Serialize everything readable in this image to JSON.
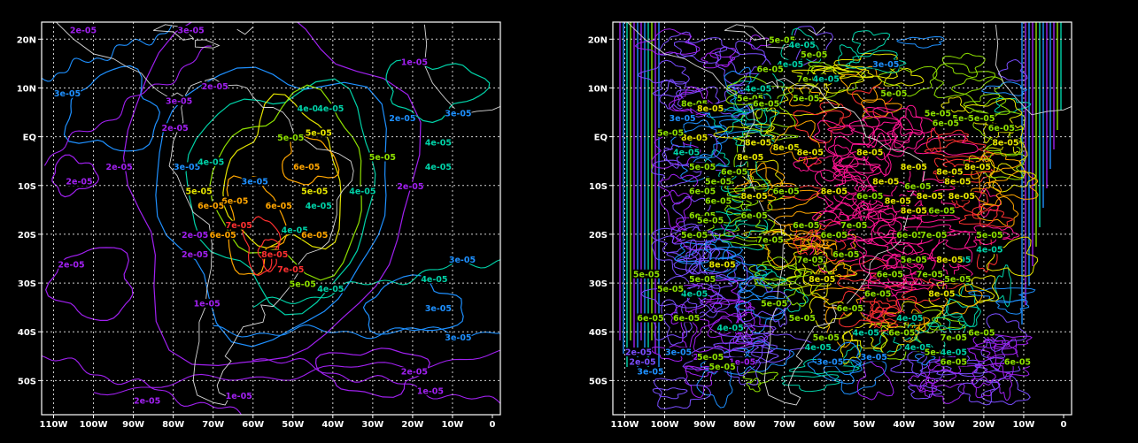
{
  "colors": {
    "c1": "#a020f0",
    "c2": "#7a4dff",
    "c3": "#1e90ff",
    "c4": "#00d2a8",
    "c5": "#8ee000",
    "c6": "#e6e600",
    "c7": "#ffa500",
    "c8": "#ff3030",
    "c9": "#ff1493"
  },
  "maps": [
    {
      "x_ticks": [
        "110W",
        "100W",
        "90W",
        "80W",
        "70W",
        "60W",
        "50W",
        "40W",
        "30W",
        "20W",
        "10W",
        "0"
      ],
      "y_ticks": [
        "20N",
        "10N",
        "EQ",
        "10S",
        "20S",
        "30S",
        "40S",
        "50S"
      ],
      "contour_labels": [
        {
          "t": "2e-05",
          "c": "c1",
          "lon": -103,
          "lat": 21.5
        },
        {
          "t": "3e-05",
          "c": "c1",
          "lon": -76,
          "lat": 21.5
        },
        {
          "t": "1e-05",
          "c": "c1",
          "lon": -20,
          "lat": 15
        },
        {
          "t": "2e-05",
          "c": "c1",
          "lon": -70,
          "lat": 10
        },
        {
          "t": "3e-05",
          "c": "c1",
          "lon": -79,
          "lat": 7
        },
        {
          "t": "3e-05",
          "c": "c3",
          "lon": -107,
          "lat": 8.5
        },
        {
          "t": "2e-05",
          "c": "c1",
          "lon": -80,
          "lat": 1.5
        },
        {
          "t": "4e-05",
          "c": "c4",
          "lon": -46,
          "lat": 5.5
        },
        {
          "t": "4e-05",
          "c": "c4",
          "lon": -41,
          "lat": 5.5
        },
        {
          "t": "2e-05",
          "c": "c3",
          "lon": -23,
          "lat": 3.5
        },
        {
          "t": "3e-05",
          "c": "c3",
          "lon": -9,
          "lat": 4.5
        },
        {
          "t": "4e-05",
          "c": "c4",
          "lon": -14,
          "lat": -1.5
        },
        {
          "t": "5e-05",
          "c": "c5",
          "lon": -51,
          "lat": -0.5
        },
        {
          "t": "5e-05",
          "c": "c6",
          "lon": -44,
          "lat": 0.5
        },
        {
          "t": "5e-05",
          "c": "c5",
          "lon": -28,
          "lat": -4.5
        },
        {
          "t": "4e-05",
          "c": "c4",
          "lon": -14,
          "lat": -6.5
        },
        {
          "t": "2e-05",
          "c": "c1",
          "lon": -94,
          "lat": -6.5
        },
        {
          "t": "3e-05",
          "c": "c3",
          "lon": -77,
          "lat": -6.5
        },
        {
          "t": "4e-05",
          "c": "c4",
          "lon": -71,
          "lat": -5.5
        },
        {
          "t": "6e-05",
          "c": "c7",
          "lon": -47,
          "lat": -6.5
        },
        {
          "t": "2e-05",
          "c": "c1",
          "lon": -104,
          "lat": -9.5
        },
        {
          "t": "3e-05",
          "c": "c3",
          "lon": -60,
          "lat": -9.5
        },
        {
          "t": "5e-05",
          "c": "c6",
          "lon": -45,
          "lat": -11.5
        },
        {
          "t": "4e-05",
          "c": "c4",
          "lon": -33,
          "lat": -11.5
        },
        {
          "t": "2e-05",
          "c": "c1",
          "lon": -21,
          "lat": -10.5
        },
        {
          "t": "5e-05",
          "c": "c6",
          "lon": -74,
          "lat": -11.5
        },
        {
          "t": "6e-05",
          "c": "c7",
          "lon": -65,
          "lat": -13.5
        },
        {
          "t": "6e-05",
          "c": "c7",
          "lon": -54,
          "lat": -14.5
        },
        {
          "t": "4e-05",
          "c": "c4",
          "lon": -44,
          "lat": -14.5
        },
        {
          "t": "6e-05",
          "c": "c7",
          "lon": -71,
          "lat": -14.5
        },
        {
          "t": "4e-05",
          "c": "c4",
          "lon": -50,
          "lat": -19.5
        },
        {
          "t": "7e-05",
          "c": "c8",
          "lon": -64,
          "lat": -18.5
        },
        {
          "t": "6e-05",
          "c": "c7",
          "lon": -68,
          "lat": -20.5
        },
        {
          "t": "6e-05",
          "c": "c7",
          "lon": -45,
          "lat": -20.5
        },
        {
          "t": "2e-05",
          "c": "c1",
          "lon": -75,
          "lat": -20.5
        },
        {
          "t": "2e-05",
          "c": "c1",
          "lon": -75,
          "lat": -24.5
        },
        {
          "t": "8e-05",
          "c": "c8",
          "lon": -55,
          "lat": -24.5
        },
        {
          "t": "7e-05",
          "c": "c8",
          "lon": -51,
          "lat": -27.5
        },
        {
          "t": "2e-05",
          "c": "c1",
          "lon": -106,
          "lat": -26.5
        },
        {
          "t": "3e-05",
          "c": "c3",
          "lon": -8,
          "lat": -25.5
        },
        {
          "t": "5e-05",
          "c": "c5",
          "lon": -48,
          "lat": -30.5
        },
        {
          "t": "4e-05",
          "c": "c4",
          "lon": -41,
          "lat": -31.5
        },
        {
          "t": "4e-05",
          "c": "c4",
          "lon": -15,
          "lat": -29.5
        },
        {
          "t": "1e-05",
          "c": "c1",
          "lon": -72,
          "lat": -34.5
        },
        {
          "t": "3e-05",
          "c": "c3",
          "lon": -14,
          "lat": -35.5
        },
        {
          "t": "3e-05",
          "c": "c3",
          "lon": -9,
          "lat": -41.5
        },
        {
          "t": "2e-05",
          "c": "c1",
          "lon": -20,
          "lat": -48.5
        },
        {
          "t": "1e-05",
          "c": "c1",
          "lon": -16,
          "lat": -52.5
        },
        {
          "t": "1e-05",
          "c": "c1",
          "lon": -64,
          "lat": -53.5
        },
        {
          "t": "2e-05",
          "c": "c1",
          "lon": -87,
          "lat": -54.5
        },
        {
          "t": "2e-05",
          "c": "c1",
          "lon": -104,
          "lat": -58.5
        }
      ]
    },
    {
      "x_ticks": [
        "110W",
        "100W",
        "90W",
        "80W",
        "70W",
        "60W",
        "50W",
        "40W",
        "30W",
        "20W",
        "10W",
        "0"
      ],
      "y_ticks": [
        "20N",
        "10N",
        "EQ",
        "10S",
        "20S",
        "30S",
        "40S",
        "50S"
      ],
      "contour_labels": [
        {
          "t": "5e-05",
          "c": "c5",
          "lon": -71,
          "lat": 19.5
        },
        {
          "t": "4e-05",
          "c": "c4",
          "lon": -66,
          "lat": 18.5
        },
        {
          "t": "4e-05",
          "c": "c4",
          "lon": -69,
          "lat": 14.5
        },
        {
          "t": "7e-05",
          "c": "c5",
          "lon": -64,
          "lat": 11.5
        },
        {
          "t": "4e-05",
          "c": "c4",
          "lon": -77,
          "lat": 9.5
        },
        {
          "t": "6e-05",
          "c": "c5",
          "lon": -74,
          "lat": 13.5
        },
        {
          "t": "5e-05",
          "c": "c5",
          "lon": -63,
          "lat": 16.5
        },
        {
          "t": "3e-05",
          "c": "c3",
          "lon": -45,
          "lat": 14.5
        },
        {
          "t": "5e-05",
          "c": "c5",
          "lon": -79,
          "lat": 7.5
        },
        {
          "t": "5e-05",
          "c": "c5",
          "lon": -65,
          "lat": 7.5
        },
        {
          "t": "4e-05",
          "c": "c4",
          "lon": -60,
          "lat": 11.5
        },
        {
          "t": "5e-05",
          "c": "c5",
          "lon": -43,
          "lat": 8.5
        },
        {
          "t": "8e-05",
          "c": "c5",
          "lon": -93,
          "lat": 6.5
        },
        {
          "t": "6e-05",
          "c": "c5",
          "lon": -75,
          "lat": 6.5
        },
        {
          "t": "8e-05",
          "c": "c6",
          "lon": -89,
          "lat": 5.5
        },
        {
          "t": "5e-05",
          "c": "c5",
          "lon": -32,
          "lat": 4.5
        },
        {
          "t": "5e-05",
          "c": "c5",
          "lon": -25,
          "lat": 3.5
        },
        {
          "t": "6e-05",
          "c": "c5",
          "lon": -30,
          "lat": 2.5
        },
        {
          "t": "5e-05",
          "c": "c5",
          "lon": -21,
          "lat": 3.5
        },
        {
          "t": "3e-05",
          "c": "c3",
          "lon": -96,
          "lat": 3.5
        },
        {
          "t": "8e-05",
          "c": "c6",
          "lon": -93,
          "lat": -0.5
        },
        {
          "t": "5e-05",
          "c": "c5",
          "lon": -99,
          "lat": 0.5
        },
        {
          "t": "6e-05",
          "c": "c5",
          "lon": -16,
          "lat": 1.5
        },
        {
          "t": "4e-05",
          "c": "c4",
          "lon": -95,
          "lat": -3.5
        },
        {
          "t": "8e-05",
          "c": "c6",
          "lon": -77,
          "lat": -1.5
        },
        {
          "t": "8e-05",
          "c": "c6",
          "lon": -70,
          "lat": -2.5
        },
        {
          "t": "8e-05",
          "c": "c6",
          "lon": -64,
          "lat": -3.5
        },
        {
          "t": "8e-05",
          "c": "c6",
          "lon": -49,
          "lat": -3.5
        },
        {
          "t": "8e-05",
          "c": "c6",
          "lon": -38,
          "lat": -6.5
        },
        {
          "t": "8e-05",
          "c": "c6",
          "lon": -29,
          "lat": -7.5
        },
        {
          "t": "8e-05",
          "c": "c6",
          "lon": -22,
          "lat": -6.5
        },
        {
          "t": "8e-05",
          "c": "c6",
          "lon": -15,
          "lat": -1.5
        },
        {
          "t": "5e-05",
          "c": "c5",
          "lon": -91,
          "lat": -6.5
        },
        {
          "t": "6e-05",
          "c": "c5",
          "lon": -83,
          "lat": -7.5
        },
        {
          "t": "8e-05",
          "c": "c6",
          "lon": -79,
          "lat": -4.5
        },
        {
          "t": "5e-05",
          "c": "c5",
          "lon": -87,
          "lat": -9.5
        },
        {
          "t": "8e-05",
          "c": "c6",
          "lon": -45,
          "lat": -9.5
        },
        {
          "t": "8e-05",
          "c": "c6",
          "lon": -27,
          "lat": -9.5
        },
        {
          "t": "6e-05",
          "c": "c5",
          "lon": -91,
          "lat": -11.5
        },
        {
          "t": "8e-05",
          "c": "c6",
          "lon": -78,
          "lat": -12.5
        },
        {
          "t": "6e-05",
          "c": "c5",
          "lon": -70,
          "lat": -11.5
        },
        {
          "t": "8e-05",
          "c": "c6",
          "lon": -58,
          "lat": -11.5
        },
        {
          "t": "6e-05",
          "c": "c5",
          "lon": -49,
          "lat": -12.5
        },
        {
          "t": "6e-05",
          "c": "c5",
          "lon": -37,
          "lat": -10.5
        },
        {
          "t": "8e-05",
          "c": "c6",
          "lon": -26,
          "lat": -12.5
        },
        {
          "t": "6e-05",
          "c": "c5",
          "lon": -87,
          "lat": -13.5
        },
        {
          "t": "8e-05",
          "c": "c6",
          "lon": -42,
          "lat": -13.5
        },
        {
          "t": "8e-05",
          "c": "c6",
          "lon": -34,
          "lat": -12.5
        },
        {
          "t": "6e-05",
          "c": "c5",
          "lon": -91,
          "lat": -16.5
        },
        {
          "t": "6e-05",
          "c": "c5",
          "lon": -78,
          "lat": -16.5
        },
        {
          "t": "8e-05",
          "c": "c6",
          "lon": -38,
          "lat": -15.5
        },
        {
          "t": "6e-05",
          "c": "c5",
          "lon": -31,
          "lat": -15.5
        },
        {
          "t": "5e-05",
          "c": "c5",
          "lon": -89,
          "lat": -17.5
        },
        {
          "t": "6e-05",
          "c": "c5",
          "lon": -65,
          "lat": -18.5
        },
        {
          "t": "7e-05",
          "c": "c5",
          "lon": -53,
          "lat": -18.5
        },
        {
          "t": "5e-05",
          "c": "c5",
          "lon": -93,
          "lat": -20.5
        },
        {
          "t": "7e-05",
          "c": "c5",
          "lon": -74,
          "lat": -21.5
        },
        {
          "t": "6e-05",
          "c": "c5",
          "lon": -58,
          "lat": -20.5
        },
        {
          "t": "6e-05",
          "c": "c5",
          "lon": -39,
          "lat": -20.5
        },
        {
          "t": "5e-05",
          "c": "c5",
          "lon": -19,
          "lat": -20.5
        },
        {
          "t": "7e-05",
          "c": "c5",
          "lon": -33,
          "lat": -20.5
        },
        {
          "t": "4e-05",
          "c": "c4",
          "lon": -19,
          "lat": -23.5
        },
        {
          "t": "8e-05",
          "c": "c6",
          "lon": -86,
          "lat": -26.5
        },
        {
          "t": "7e-05",
          "c": "c5",
          "lon": -64,
          "lat": -25.5
        },
        {
          "t": "6e-05",
          "c": "c5",
          "lon": -55,
          "lat": -24.5
        },
        {
          "t": "5e-05",
          "c": "c5",
          "lon": -38,
          "lat": -25.5
        },
        {
          "t": "4e-05",
          "c": "c4",
          "lon": -27,
          "lat": -25.5
        },
        {
          "t": "8e-05",
          "c": "c6",
          "lon": -29,
          "lat": -25.5
        },
        {
          "t": "6e-05",
          "c": "c5",
          "lon": -44,
          "lat": -28.5
        },
        {
          "t": "7e-05",
          "c": "c5",
          "lon": -34,
          "lat": -28.5
        },
        {
          "t": "5e-05",
          "c": "c5",
          "lon": -91,
          "lat": -29.5
        },
        {
          "t": "5e-05",
          "c": "c5",
          "lon": -105,
          "lat": -28.5
        },
        {
          "t": "8e-05",
          "c": "c6",
          "lon": -61,
          "lat": -29.5
        },
        {
          "t": "5e-05",
          "c": "c5",
          "lon": -27,
          "lat": -29.5
        },
        {
          "t": "8e-05",
          "c": "c6",
          "lon": -31,
          "lat": -32.5
        },
        {
          "t": "4e-05",
          "c": "c4",
          "lon": -93,
          "lat": -32.5
        },
        {
          "t": "5e-05",
          "c": "c5",
          "lon": -99,
          "lat": -31.5
        },
        {
          "t": "6e-05",
          "c": "c5",
          "lon": -47,
          "lat": -32.5
        },
        {
          "t": "6e-05",
          "c": "c5",
          "lon": -104,
          "lat": -37.5
        },
        {
          "t": "6e-05",
          "c": "c5",
          "lon": -95,
          "lat": -37.5
        },
        {
          "t": "4e-05",
          "c": "c4",
          "lon": -39,
          "lat": -37.5
        },
        {
          "t": "6e-05",
          "c": "c5",
          "lon": -41,
          "lat": -40.5
        },
        {
          "t": "4e-05",
          "c": "c4",
          "lon": -84,
          "lat": -39.5
        },
        {
          "t": "4e-05",
          "c": "c4",
          "lon": -50,
          "lat": -40.5
        },
        {
          "t": "5e-05",
          "c": "c5",
          "lon": -60,
          "lat": -41.5
        },
        {
          "t": "6e-05",
          "c": "c5",
          "lon": -21,
          "lat": -40.5
        },
        {
          "t": "7e-05",
          "c": "c5",
          "lon": -28,
          "lat": -41.5
        },
        {
          "t": "4e-05",
          "c": "c4",
          "lon": -37,
          "lat": -43.5
        },
        {
          "t": "5e-05",
          "c": "c5",
          "lon": -32,
          "lat": -44.5
        },
        {
          "t": "6e-05",
          "c": "c5",
          "lon": -12,
          "lat": -46.5
        },
        {
          "t": "6e-05",
          "c": "c5",
          "lon": -28,
          "lat": -46.5
        },
        {
          "t": "4e-05",
          "c": "c4",
          "lon": -28,
          "lat": -44.5
        },
        {
          "t": "1e-05",
          "c": "c1",
          "lon": -81,
          "lat": -46.5
        },
        {
          "t": "2e-05",
          "c": "c1",
          "lon": -90,
          "lat": -45.5
        },
        {
          "t": "3e-05",
          "c": "c3",
          "lon": -59,
          "lat": -46.5
        },
        {
          "t": "3e-05",
          "c": "c3",
          "lon": -48,
          "lat": -45.5
        },
        {
          "t": "5e-05",
          "c": "c5",
          "lon": -89,
          "lat": -45.5
        },
        {
          "t": "5e-05",
          "c": "c5",
          "lon": -86,
          "lat": -47.5
        },
        {
          "t": "3e-05",
          "c": "c3",
          "lon": -104,
          "lat": -48.5
        },
        {
          "t": "2e-05",
          "c": "c2",
          "lon": -106,
          "lat": -46.5
        },
        {
          "t": "2e-05",
          "c": "c2",
          "lon": -107,
          "lat": -44.5
        },
        {
          "t": "3e-05",
          "c": "c3",
          "lon": -97,
          "lat": -44.5
        },
        {
          "t": "4e-05",
          "c": "c4",
          "lon": -62,
          "lat": -43.5
        },
        {
          "t": "5e-05",
          "c": "c5",
          "lon": -66,
          "lat": -37.5
        },
        {
          "t": "6e-05",
          "c": "c5",
          "lon": -54,
          "lat": -35.5
        },
        {
          "t": "5e-05",
          "c": "c5",
          "lon": -73,
          "lat": -34.5
        }
      ]
    }
  ]
}
